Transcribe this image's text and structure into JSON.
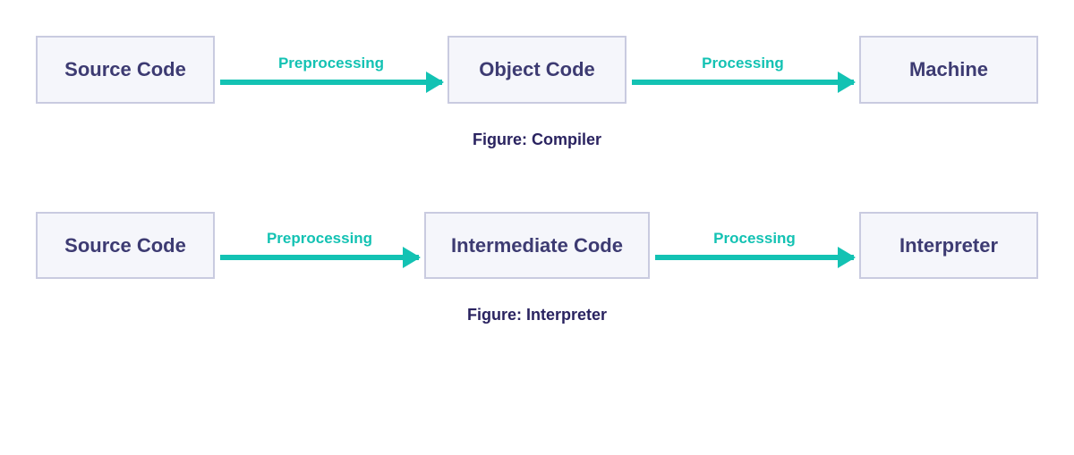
{
  "diagrams": [
    {
      "caption": "Figure: Compiler",
      "nodes": [
        "Source Code",
        "Object Code",
        "Machine"
      ],
      "arrows": [
        "Preprocessing",
        "Processing"
      ]
    },
    {
      "caption": "Figure: Interpreter",
      "nodes": [
        "Source Code",
        "Intermediate Code",
        "Interpreter"
      ],
      "arrows": [
        "Preprocessing",
        "Processing"
      ]
    }
  ],
  "colors": {
    "node_bg": "#f5f6fb",
    "node_border": "#c9cbe0",
    "node_text": "#3d3b72",
    "arrow": "#13c2b3",
    "caption": "#2a2360"
  }
}
